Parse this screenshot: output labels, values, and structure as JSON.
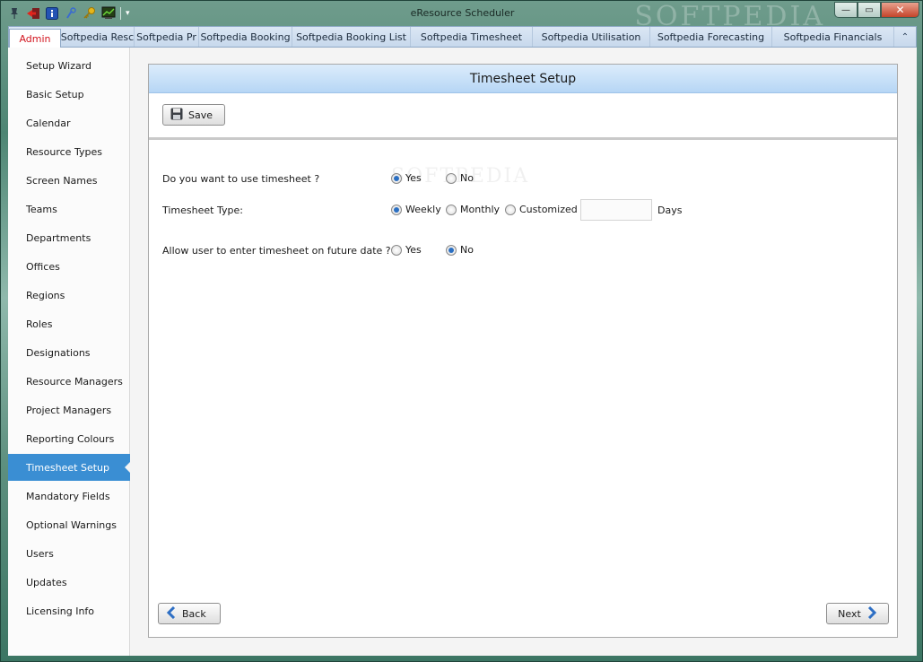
{
  "window": {
    "title": "eResource Scheduler",
    "watermark": "SOFTPEDIA",
    "controls": {
      "minimize": "—",
      "maximize": "▭",
      "close": "✕"
    }
  },
  "quick_access": {
    "icons": [
      "pin-icon",
      "exit-icon",
      "info-icon",
      "help-icon",
      "key-icon",
      "chart-icon"
    ],
    "dropdown": "▾"
  },
  "tabs": [
    {
      "label": "Admin",
      "active": true
    },
    {
      "label": "Softpedia Resc"
    },
    {
      "label": "Softpedia Pr"
    },
    {
      "label": "Softpedia Booking"
    },
    {
      "label": "Softpedia Booking List"
    },
    {
      "label": "Softpedia Timesheet"
    },
    {
      "label": "Softpedia Utilisation"
    },
    {
      "label": "Softpedia Forecasting"
    },
    {
      "label": "Softpedia Financials"
    }
  ],
  "tab_collapse": "⌃",
  "sidebar": {
    "items": [
      {
        "label": "Setup Wizard"
      },
      {
        "label": "Basic Setup"
      },
      {
        "label": "Calendar"
      },
      {
        "label": "Resource Types"
      },
      {
        "label": "Screen Names"
      },
      {
        "label": "Teams"
      },
      {
        "label": "Departments"
      },
      {
        "label": "Offices"
      },
      {
        "label": "Regions"
      },
      {
        "label": "Roles"
      },
      {
        "label": "Designations"
      },
      {
        "label": "Resource Managers"
      },
      {
        "label": "Project Managers"
      },
      {
        "label": "Reporting Colours"
      },
      {
        "label": "Timesheet Setup",
        "active": true
      },
      {
        "label": "Mandatory Fields"
      },
      {
        "label": "Optional Warnings"
      },
      {
        "label": "Users"
      },
      {
        "label": "Updates"
      },
      {
        "label": "Licensing Info"
      }
    ]
  },
  "panel": {
    "title": "Timesheet Setup",
    "save_label": "Save",
    "back_label": "Back",
    "next_label": "Next",
    "watermark": "SOFTPEDIA",
    "questions": {
      "use_timesheet": {
        "label": "Do you want to use timesheet ?",
        "options": [
          "Yes",
          "No"
        ],
        "selected": "Yes"
      },
      "timesheet_type": {
        "label": "Timesheet Type:",
        "options": [
          "Weekly",
          "Monthly",
          "Customized"
        ],
        "selected": "Weekly",
        "days_value": "",
        "days_label": "Days"
      },
      "future_date": {
        "label": "Allow user to enter timesheet on future date ?",
        "options": [
          "Yes",
          "No"
        ],
        "selected": "No"
      }
    }
  }
}
